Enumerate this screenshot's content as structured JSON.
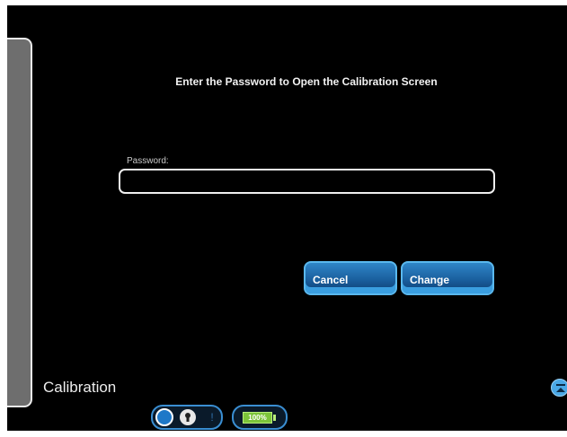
{
  "dialog": {
    "prompt": "Enter the Password to Open the Calibration Screen",
    "password_label": "Password:",
    "password_value": ""
  },
  "buttons": {
    "cancel": "Cancel",
    "change": "Change"
  },
  "screen": {
    "title": "Calibration"
  },
  "status_bar": {
    "lock_icon": "lock-icon",
    "info_icon": "info-icon",
    "battery": "100%"
  },
  "colors": {
    "background": "#000000",
    "button_accent": "#2f86c8",
    "battery_fill": "#7cc43a"
  }
}
